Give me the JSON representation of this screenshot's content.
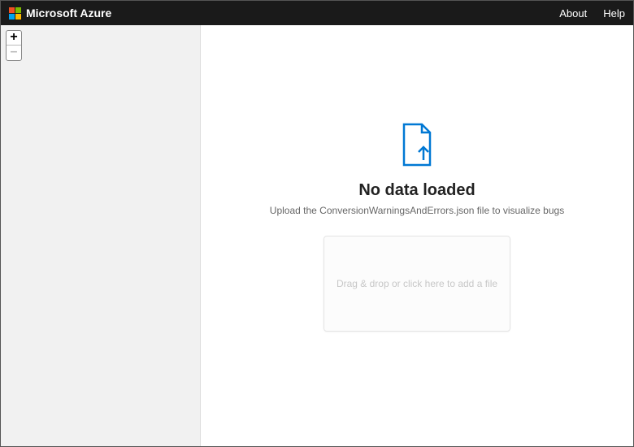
{
  "topbar": {
    "brand": "Microsoft Azure",
    "links": {
      "about": "About",
      "help": "Help"
    }
  },
  "zoom": {
    "in_label": "+",
    "out_label": "–"
  },
  "main": {
    "icon": "document-upload-icon",
    "title": "No data loaded",
    "subtitle": "Upload the ConversionWarningsAndErrors.json file to visualize bugs",
    "dropzone_text": "Drag & drop or click here to add a file"
  },
  "colors": {
    "accent": "#0078d4"
  }
}
